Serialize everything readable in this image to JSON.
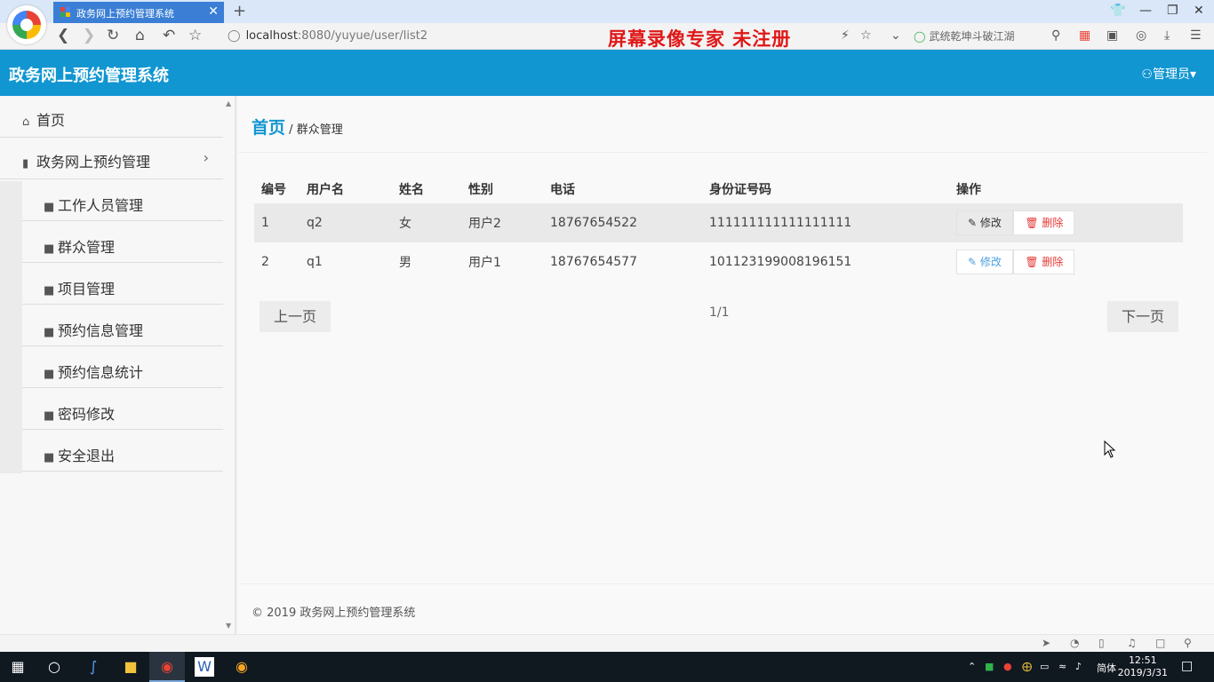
{
  "browser": {
    "tab_title": "政务网上预约管理系统",
    "tab_close": "✕",
    "new_tab": "+",
    "url_host": "localhost",
    "url_path": ":8080/yuyue/user/list2",
    "watermark": "屏幕录像专家  未注册",
    "search_placeholder": "武统乾坤斗破江湖"
  },
  "app": {
    "title": "政务网上预约管理系统",
    "user_menu": "管理员"
  },
  "sidebar": {
    "home": "首页",
    "group": "政务网上预约管理",
    "items": [
      {
        "label": "工作人员管理"
      },
      {
        "label": "群众管理"
      },
      {
        "label": "项目管理"
      },
      {
        "label": "预约信息管理"
      },
      {
        "label": "预约信息统计"
      },
      {
        "label": "密码修改"
      },
      {
        "label": "安全退出"
      }
    ]
  },
  "breadcrumb": {
    "home": "首页",
    "separator": "/",
    "current": "群众管理"
  },
  "table": {
    "headers": [
      "编号",
      "用户名",
      "姓名",
      "性别",
      "电话",
      "身份证号码",
      "操作"
    ],
    "rows": [
      {
        "id": "1",
        "username": "q2",
        "name": "女",
        "gender": "用户2",
        "phone": "18767654522",
        "idcard": "111111111111111111"
      },
      {
        "id": "2",
        "username": "q1",
        "name": "男",
        "gender": "用户1",
        "phone": "18767654577",
        "idcard": "101123199008196151"
      }
    ],
    "edit_label": "修改",
    "delete_label": "删除"
  },
  "pager": {
    "prev": "上一页",
    "info": "1/1",
    "next": "下一页"
  },
  "footer": "© 2019 政务网上预约管理系统",
  "taskbar": {
    "ime": "简体",
    "time": "12:51",
    "date": "2019/3/31"
  },
  "colors": {
    "brand": "#1196d1",
    "delete": "#e53935",
    "watermark": "#e01818"
  }
}
